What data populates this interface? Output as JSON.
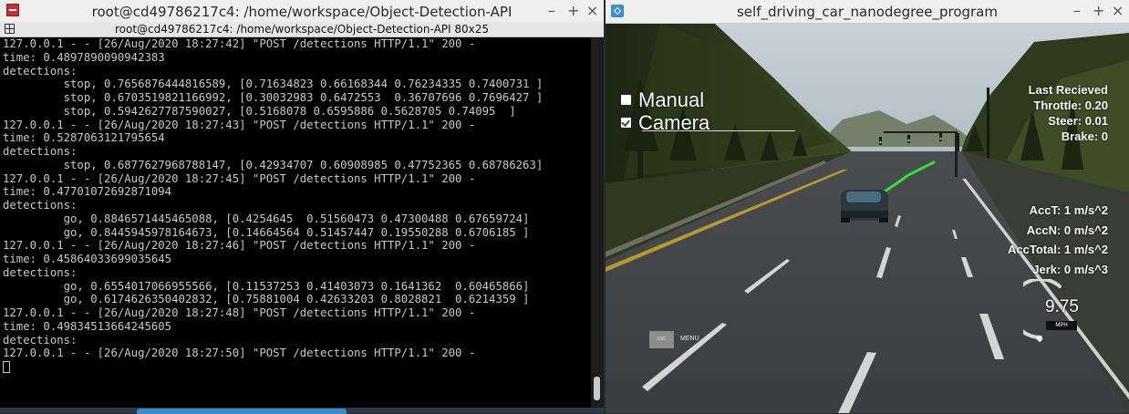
{
  "terminal": {
    "window_title": "root@cd49786217c4: /home/workspace/Object-Detection-API",
    "subtitle": "root@cd49786217c4: /home/workspace/Object-Detection-API 80x25",
    "lines": [
      "127.0.0.1 - - [26/Aug/2020 18:27:42] \"POST /detections HTTP/1.1\" 200 -",
      "time: 0.4897890090942383",
      "detections:",
      "         stop, 0.7656876444816589, [0.71634823 0.66168344 0.76234335 0.7400731 ]",
      "         stop, 0.6703519821166992, [0.30032983 0.6472553  0.36707696 0.7696427 ]",
      "         stop, 0.5942627787590027, [0.5168078 0.6595886 0.5628705 0.74095  ]",
      "127.0.0.1 - - [26/Aug/2020 18:27:43] \"POST /detections HTTP/1.1\" 200 -",
      "time: 0.5287063121795654",
      "detections:",
      "         stop, 0.6877627968788147, [0.42934707 0.60908985 0.47752365 0.68786263]",
      "127.0.0.1 - - [26/Aug/2020 18:27:45] \"POST /detections HTTP/1.1\" 200 -",
      "time: 0.47701072692871094",
      "detections:",
      "         go, 0.8846571445465088, [0.4254645  0.51560473 0.47300488 0.67659724]",
      "         go, 0.8445945978164673, [0.14664564 0.51457447 0.19550288 0.6706185 ]",
      "127.0.0.1 - - [26/Aug/2020 18:27:46] \"POST /detections HTTP/1.1\" 200 -",
      "time: 0.45864033699035645",
      "detections:",
      "         go, 0.6554017066955566, [0.11537253 0.41403073 0.1641362  0.60465866]",
      "         go, 0.6174626350402832, [0.75881004 0.42633203 0.8028821  0.6214359 ]",
      "127.0.0.1 - - [26/Aug/2020 18:27:48] \"POST /detections HTTP/1.1\" 200 -",
      "time: 0.49834513664245605",
      "detections:",
      "127.0.0.1 - - [26/Aug/2020 18:27:50] \"POST /detections HTTP/1.1\" 200 -"
    ]
  },
  "simulator": {
    "window_title": "self_driving_car_nanodegree_program",
    "controls": {
      "manual_label": "Manual",
      "manual_checked": false,
      "camera_label": "Camera",
      "camera_checked": true
    },
    "status": {
      "last_received": "Last Recieved",
      "throttle": "Throttle: 0.20",
      "steer": "Steer: 0.01",
      "brake": "Brake: 0"
    },
    "accel": {
      "acc_t": "AccT: 1 m/s^2",
      "acc_n": "AccN: 0 m/s^2",
      "acc_total": "AccTotal: 1 m/s^2",
      "jerk": "Jerk: 0 m/s^3"
    },
    "esc_label": "ESC",
    "menu_label": "MENU",
    "speed": "9.75",
    "speed_unit": "MPH"
  },
  "window_buttons": {
    "minimize": "–",
    "maximize": "+",
    "close": "×"
  }
}
